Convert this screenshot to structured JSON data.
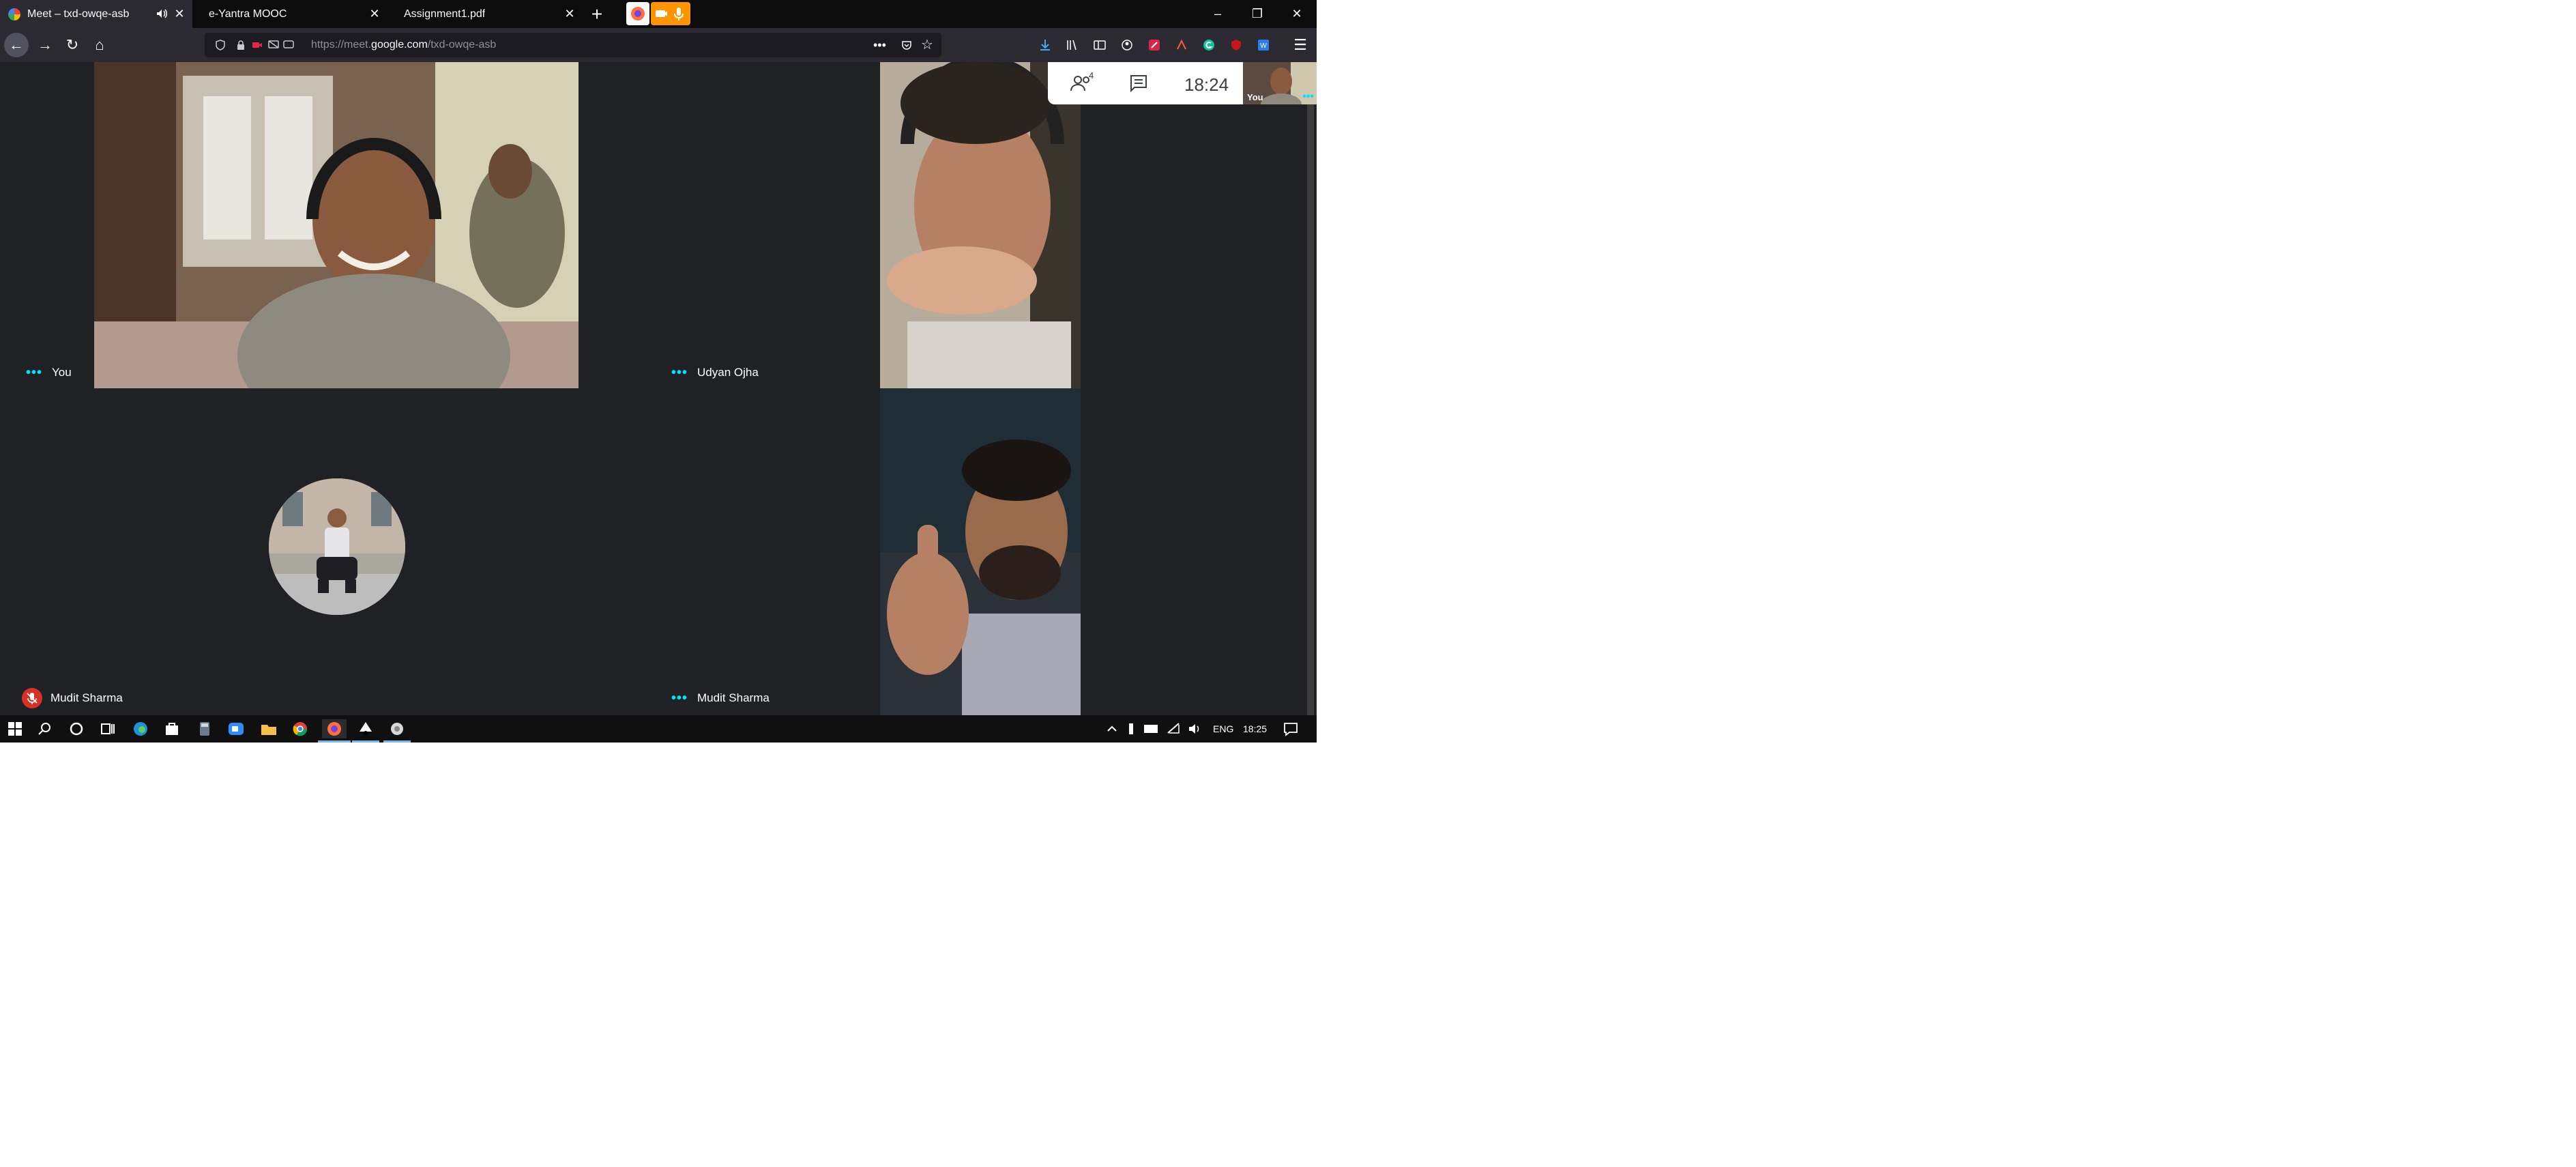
{
  "browser": {
    "tabs": [
      {
        "title": "Meet – txd-owqe-asb",
        "active": true,
        "favicon": "google-meet-icon",
        "audio": true
      },
      {
        "title": "e-Yantra MOOC",
        "active": false,
        "favicon": "none"
      },
      {
        "title": "Assignment1.pdf",
        "active": false,
        "favicon": "none"
      }
    ],
    "new_tab_label": "+",
    "url": {
      "prefix": "https://meet.",
      "host": "google.com",
      "path": "/txd-owqe-asb"
    },
    "window_controls": {
      "minimize": "–",
      "restore": "❐",
      "close": "✕"
    },
    "colors": {
      "tabbar": "#0c0c0d",
      "toolbar": "#2b2a33",
      "urlbar": "#1c1b22",
      "extension_orange": "#ff9400"
    }
  },
  "meet": {
    "participants": [
      {
        "name": "You",
        "muted": false
      },
      {
        "name": "Udyan Ojha",
        "muted": false
      },
      {
        "name": "Mudit Sharma",
        "muted": true,
        "camera_off": true
      },
      {
        "name": "Mudit Sharma",
        "muted": false
      }
    ],
    "people_count": "4",
    "clock": "18:24",
    "self_view_label": "You",
    "more_dots": "•••",
    "colors": {
      "background": "#202124",
      "dots_accent": "#00e3ff",
      "mute_red": "#d93025"
    }
  },
  "taskbar": {
    "language": "ENG",
    "time": "18:25",
    "apps": [
      "start-icon",
      "search-icon",
      "cortana-icon",
      "task-view-icon",
      "edge-icon",
      "store-icon",
      "calculator-icon",
      "zoom-icon",
      "file-explorer-icon",
      "chrome-icon",
      "firefox-icon",
      "inkscape-icon",
      "app-icon"
    ]
  }
}
